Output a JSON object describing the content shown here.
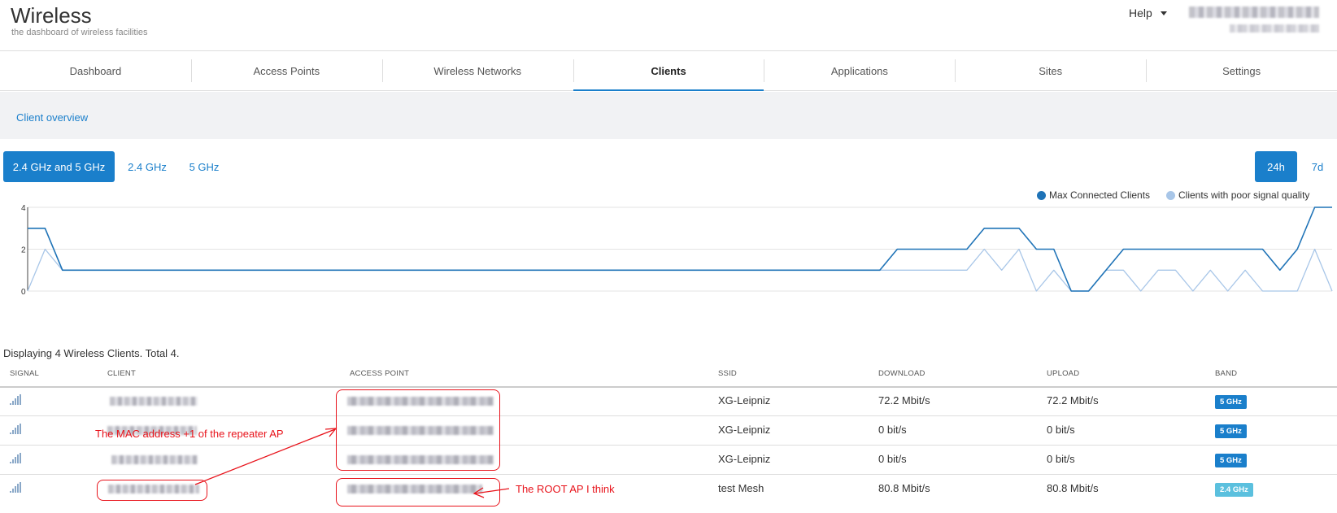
{
  "header": {
    "title": "Wireless",
    "subtitle": "the dashboard of wireless facilities",
    "help_label": "Help"
  },
  "nav": {
    "tabs": [
      {
        "label": "Dashboard",
        "active": false
      },
      {
        "label": "Access Points",
        "active": false
      },
      {
        "label": "Wireless Networks",
        "active": false
      },
      {
        "label": "Clients",
        "active": true
      },
      {
        "label": "Applications",
        "active": false
      },
      {
        "label": "Sites",
        "active": false
      },
      {
        "label": "Settings",
        "active": false
      }
    ]
  },
  "subbar": {
    "link": "Client overview"
  },
  "band_filter": {
    "options": [
      "2.4 GHz and 5 GHz",
      "2.4 GHz",
      "5 GHz"
    ],
    "selected": "2.4 GHz and 5 GHz"
  },
  "range_filter": {
    "options": [
      "24h",
      "7d"
    ],
    "selected": "24h"
  },
  "colors": {
    "accent": "#1a7fcb",
    "max_series": "#1f73b7",
    "poor_series": "#a8c6e8",
    "band_5": "#1a7fcb",
    "band_24": "#5bc0de",
    "annotation": "#e8131b"
  },
  "chart_data": {
    "type": "line",
    "title": "",
    "xlabel": "",
    "ylabel": "",
    "ylim": [
      0,
      4
    ],
    "yticks": [
      "0",
      "2",
      "4"
    ],
    "grid": true,
    "legend_position": "top-right",
    "x": [
      0,
      1,
      2,
      3,
      4,
      5,
      6,
      7,
      8,
      9,
      10,
      11,
      12,
      13,
      14,
      15,
      16,
      17,
      18,
      19,
      20,
      21,
      22,
      23,
      24,
      25,
      26,
      27,
      28,
      29,
      30,
      31,
      32,
      33,
      34,
      35,
      36,
      37,
      38,
      39,
      40,
      41,
      42,
      43,
      44,
      45,
      46,
      47,
      48,
      49,
      50,
      51,
      52,
      53,
      54,
      55,
      56,
      57,
      58,
      59,
      60,
      61,
      62,
      63,
      64,
      65,
      66,
      67,
      68,
      69,
      70,
      71,
      72,
      73,
      74,
      75
    ],
    "series": [
      {
        "name": "Max Connected Clients",
        "values": [
          3,
          3,
          1,
          1,
          1,
          1,
          1,
          1,
          1,
          1,
          1,
          1,
          1,
          1,
          1,
          1,
          1,
          1,
          1,
          1,
          1,
          1,
          1,
          1,
          1,
          1,
          1,
          1,
          1,
          1,
          1,
          1,
          1,
          1,
          1,
          1,
          1,
          1,
          1,
          1,
          1,
          1,
          1,
          1,
          1,
          1,
          1,
          1,
          1,
          1,
          2,
          2,
          2,
          2,
          2,
          3,
          3,
          3,
          2,
          2,
          0,
          0,
          1,
          2,
          2,
          2,
          2,
          2,
          2,
          2,
          2,
          2,
          1,
          2,
          4,
          4
        ]
      },
      {
        "name": "Clients with poor signal quality",
        "values": [
          0,
          2,
          1,
          1,
          1,
          1,
          1,
          1,
          1,
          1,
          1,
          1,
          1,
          1,
          1,
          1,
          1,
          1,
          1,
          1,
          1,
          1,
          1,
          1,
          1,
          1,
          1,
          1,
          1,
          1,
          1,
          1,
          1,
          1,
          1,
          1,
          1,
          1,
          1,
          1,
          1,
          1,
          1,
          1,
          1,
          1,
          1,
          1,
          1,
          1,
          1,
          1,
          1,
          1,
          1,
          2,
          1,
          2,
          0,
          1,
          0,
          0,
          1,
          1,
          0,
          1,
          1,
          0,
          1,
          0,
          1,
          0,
          0,
          0,
          2,
          0
        ]
      }
    ]
  },
  "summary": "Displaying 4 Wireless Clients. Total 4.",
  "table": {
    "columns": [
      "SIGNAL",
      "CLIENT",
      "ACCESS POINT",
      "SSID",
      "DOWNLOAD",
      "UPLOAD",
      "BAND"
    ],
    "rows": [
      {
        "ssid": "XG-Leipniz",
        "download": "72.2 Mbit/s",
        "upload": "72.2 Mbit/s",
        "band": "5 GHz"
      },
      {
        "ssid": "XG-Leipniz",
        "download": "0 bit/s",
        "upload": "0 bit/s",
        "band": "5 GHz"
      },
      {
        "ssid": "XG-Leipniz",
        "download": "0 bit/s",
        "upload": "0 bit/s",
        "band": "5 GHz"
      },
      {
        "ssid": "test Mesh",
        "download": "80.8 Mbit/s",
        "upload": "80.8 Mbit/s",
        "band": "2.4 GHz"
      }
    ]
  },
  "annotations": {
    "repeater_note": "The MAC address +1 of the repeater AP",
    "root_note": "The ROOT AP I think"
  }
}
